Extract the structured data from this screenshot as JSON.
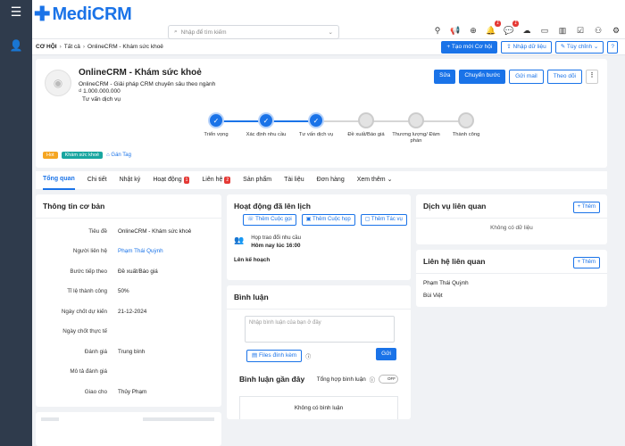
{
  "app": {
    "logo_text": "MediCRM"
  },
  "search": {
    "placeholder": "Nhập để tìm kiếm"
  },
  "breadcrumb": {
    "root": "CƠ HỘI",
    "level2": "Tất cả",
    "current": "OnlineCRM - Khám sức khoẻ"
  },
  "subbar_actions": {
    "new_opportunity": "+ Tạo mới Cơ hội",
    "import": "Nhập dữ liệu",
    "customize": "Tùy chỉnh"
  },
  "deal": {
    "title": "OnlineCRM - Khám sức khoẻ",
    "subtitle": "OnlineCRM - Giải pháp CRM chuyên sâu theo ngành",
    "amount": "₫ 1.000.000.000",
    "stage": "Tư vấn dịch vụ",
    "actions": {
      "edit": "Sửa",
      "next_stage": "Chuyển bước",
      "send_mail": "Gửi mail",
      "follow": "Theo dõi"
    }
  },
  "pipeline": [
    {
      "label": "Triển vọng",
      "done": true
    },
    {
      "label": "Xác định nhu cầu",
      "done": true
    },
    {
      "label": "Tư vấn dịch vụ",
      "done": true
    },
    {
      "label": "Đề xuất/Báo giá",
      "done": false
    },
    {
      "label": "Thương lượng/ Đàm phán",
      "done": false
    },
    {
      "label": "Thành công",
      "done": false
    }
  ],
  "tags": [
    {
      "label": "Hot",
      "color": "#f5a623"
    },
    {
      "label": "Khám sức khoẻ",
      "color": "#18a6a0"
    }
  ],
  "tag_add_label": "Gán Tag",
  "tabs": [
    {
      "label": "Tổng quan",
      "count": ""
    },
    {
      "label": "Chi tiết",
      "count": ""
    },
    {
      "label": "Nhật ký",
      "count": ""
    },
    {
      "label": "Hoạt động",
      "count": "1"
    },
    {
      "label": "Liên hệ",
      "count": "2"
    },
    {
      "label": "Sản phẩm",
      "count": ""
    },
    {
      "label": "Tài liệu",
      "count": ""
    },
    {
      "label": "Đơn hàng",
      "count": ""
    },
    {
      "label": "Xem thêm",
      "count": ""
    }
  ],
  "basic_info": {
    "title": "Thông tin cơ bản",
    "rows": [
      {
        "label": "Tiêu đề",
        "value": "OnlineCRM - Khám sức khoẻ",
        "link": false
      },
      {
        "label": "Người liên hệ",
        "value": "Phạm Thái Quỳnh",
        "link": true
      },
      {
        "label": "Bước tiếp theo",
        "value": "Đề xuất/Báo giá",
        "link": false
      },
      {
        "label": "Tỉ lệ thành công",
        "value": "50%",
        "link": false
      },
      {
        "label": "Ngày chốt dự kiến",
        "value": "21-12-2024",
        "link": false
      },
      {
        "label": "Ngày chốt thực tế",
        "value": "",
        "link": false
      },
      {
        "label": "Đánh giá",
        "value": "Trung bình",
        "link": false
      },
      {
        "label": "Mô tả đánh giá",
        "value": "",
        "link": false
      },
      {
        "label": "Giao cho",
        "value": "Thủy Phạm",
        "link": false
      }
    ]
  },
  "activities": {
    "title": "Hoạt động đã lên lịch",
    "add_call": "Thêm Cuộc gọi",
    "add_meeting": "Thêm Cuộc họp",
    "add_task": "Thêm Tác vụ",
    "item_title": "Họp trao đổi nhu cầu",
    "item_time": "Hôm nay lúc 16:00",
    "plan_label": "Lên kế hoạch"
  },
  "comments": {
    "title": "Bình luận",
    "placeholder": "Nhập bình luận của bạn ở đây",
    "attach": "Files đính kèm",
    "send": "Gửi",
    "recent": "Bình luận gần đây",
    "summary": "Tổng hợp bình luận",
    "toggle": "OFF",
    "empty": "Không có bình luận"
  },
  "services": {
    "title": "Dịch vụ liên quan",
    "add": "+ Thêm",
    "empty": "Không có dữ liệu"
  },
  "contacts": {
    "title": "Liên hệ liên quan",
    "add": "+ Thêm",
    "items": [
      "Phạm Thái Quỳnh",
      "Bùi Việt"
    ]
  },
  "top_badges": {
    "notifications": "1",
    "messages": "1"
  }
}
